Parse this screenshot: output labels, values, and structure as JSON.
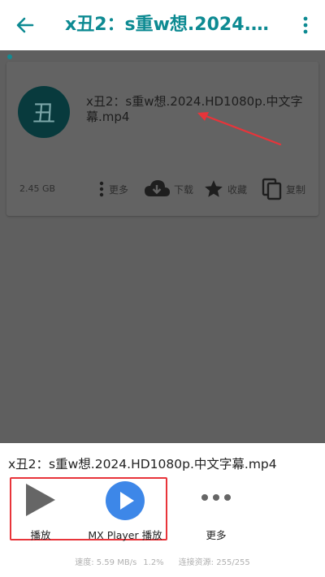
{
  "appbar": {
    "title": "x丑2：s重w想.2024.…",
    "back_icon": "arrow-left-icon",
    "menu_icon": "more-vertical-icon",
    "accent": "#0d8a92"
  },
  "card": {
    "avatar_text": "丑",
    "file_name": "x丑2：s重w想.2024.HD1080p.中文字幕.mp4",
    "size": "2.45 GB",
    "actions": {
      "more": "更多",
      "download": "下载",
      "favorite": "收藏",
      "copy": "复制"
    }
  },
  "sheet": {
    "file_name": "x丑2：s重w想.2024.HD1080p.中文字幕.mp4",
    "options": {
      "play": "播放",
      "mx_play": "MX Player 播放",
      "more": "更多"
    },
    "status": {
      "speed": "速度: 5.59 MB/s",
      "percent": "1.2%",
      "sources": "连接资源: 255/255"
    },
    "highlight_color": "#e8343a"
  }
}
